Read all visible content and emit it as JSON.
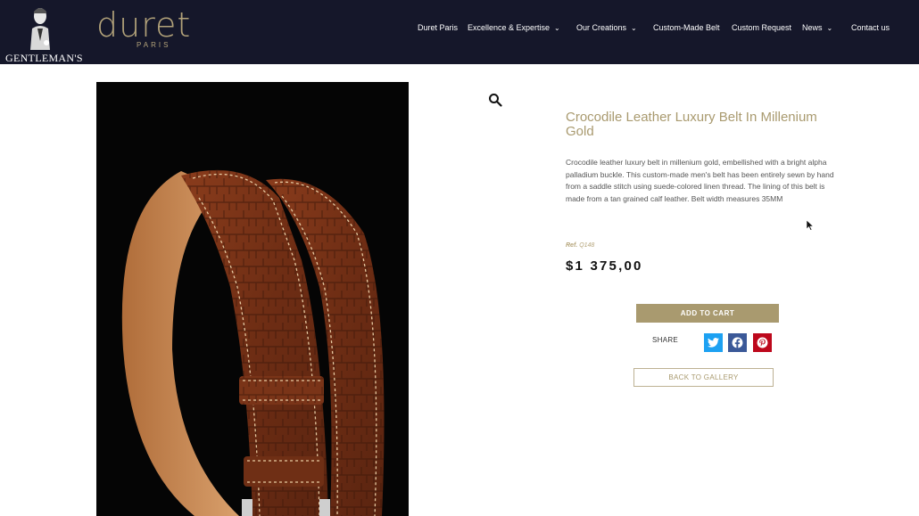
{
  "header": {
    "gentlemans_logo_text": "GENTLEMAN'S",
    "brand_logo": {
      "word": "duret",
      "sub": "PARIS"
    },
    "nav": [
      {
        "label": "Duret Paris",
        "has_dropdown": false
      },
      {
        "label": "Excellence & Expertise",
        "has_dropdown": true
      },
      {
        "label": "Our Creations",
        "has_dropdown": true
      },
      {
        "label": "Custom-Made Belt",
        "has_dropdown": false
      },
      {
        "label": "Custom Request",
        "has_dropdown": false
      },
      {
        "label": "News",
        "has_dropdown": true
      },
      {
        "label": "Contact us",
        "has_dropdown": false
      }
    ]
  },
  "product": {
    "title": "Crocodile Leather Luxury Belt In Millenium Gold",
    "description": "Crocodile leather luxury belt in millenium gold, embellished with a bright alpha palladium buckle. This custom-made men's belt has been entirely sewn by hand from a saddle stitch using suede-colored linen thread. The lining of this belt is made from a tan grained calf leather. Belt width measures 35MM",
    "ref_label": "Ref.",
    "ref_value": "Q148",
    "price": "$1 375,00",
    "add_to_cart": "ADD TO CART",
    "share_label": "SHARE",
    "back_to_gallery": "BACK TO GALLERY"
  },
  "icons": {
    "chevron": "chevron-down-icon",
    "zoom": "magnifier-icon",
    "share": [
      "twitter-icon",
      "facebook-icon",
      "pinterest-icon"
    ]
  },
  "colors": {
    "header_bg": "#15172a",
    "accent_gold": "#a99a6f",
    "twitter": "#1da1f2",
    "facebook": "#3b5998",
    "pinterest": "#bd081c"
  }
}
